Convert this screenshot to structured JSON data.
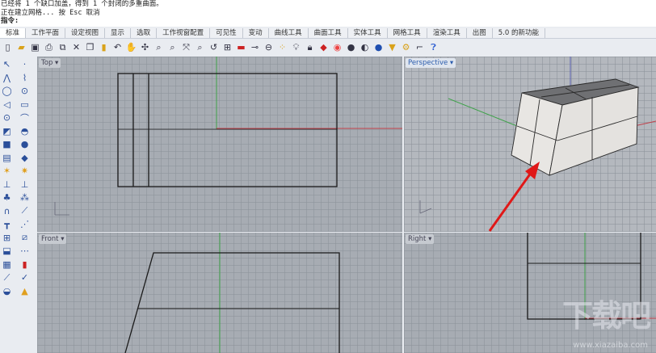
{
  "command": {
    "lines": [
      "已经将 1 个缺口加盖，得到 1 个封闭的多重曲面。",
      "正在建立网格... 按 Esc 取消"
    ],
    "prompt": "指令:"
  },
  "tabs": [
    "标准",
    "工作平面",
    "设定视图",
    "显示",
    "选取",
    "工作视窗配置",
    "可见性",
    "变动",
    "曲线工具",
    "曲面工具",
    "实体工具",
    "网格工具",
    "渲染工具",
    "出图",
    "5.0 的新功能"
  ],
  "viewports": {
    "top": "Top",
    "perspective": "Perspective",
    "front": "Front",
    "right": "Right"
  },
  "watermark": {
    "logo": "下载吧",
    "url": "www.xiazaiba.com"
  },
  "colors": {
    "x_axis": "#c0404a",
    "y_axis": "#3fa24a",
    "z_axis": "#5a5fb0",
    "arrow": "#e01818"
  }
}
